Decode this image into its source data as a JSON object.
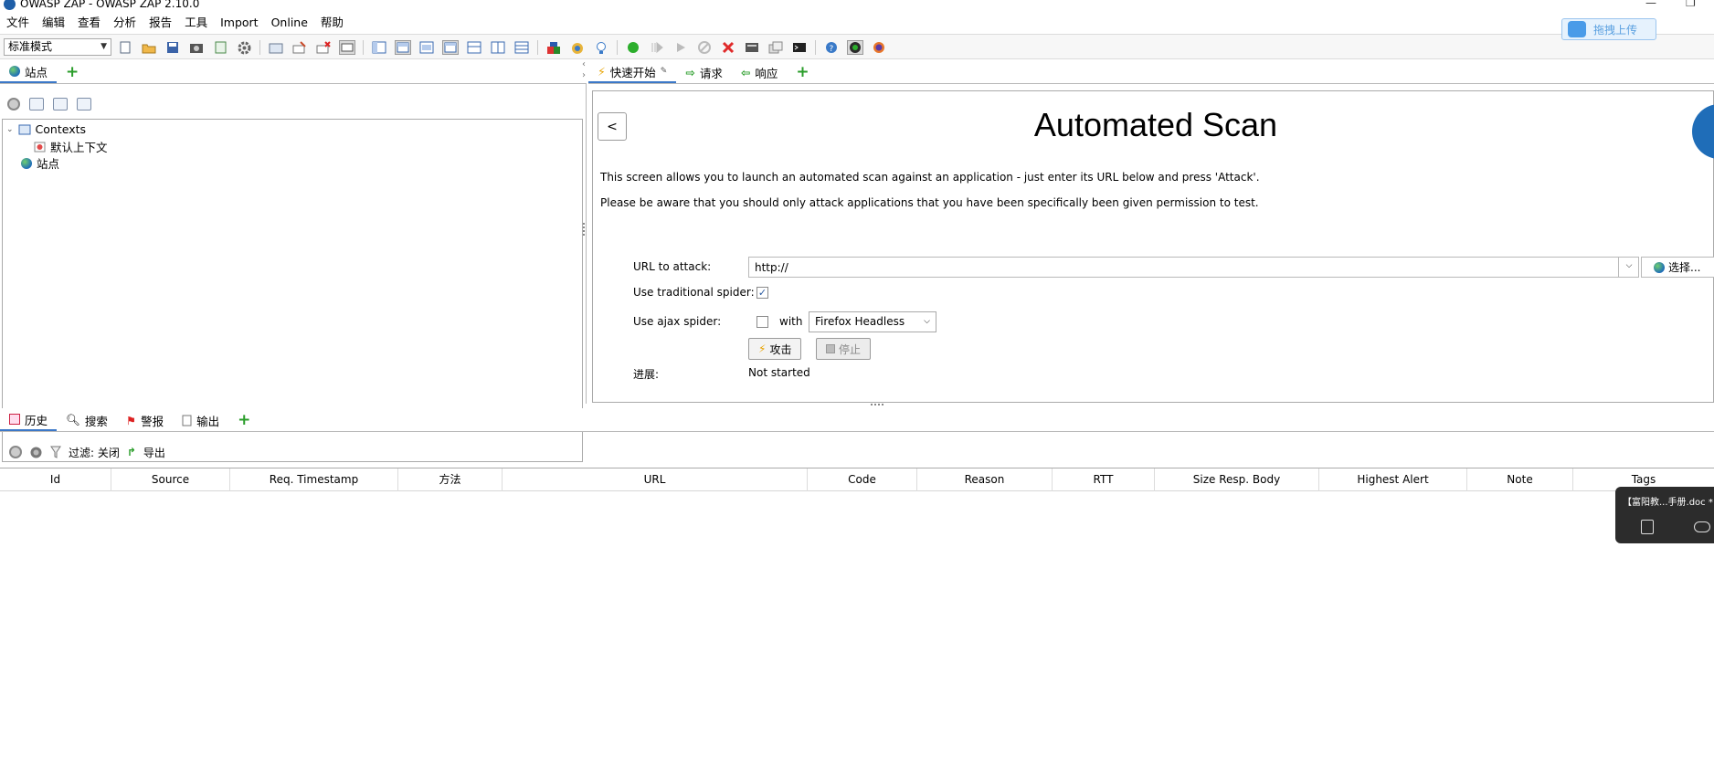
{
  "window": {
    "title": "OWASP ZAP - OWASP ZAP 2.10.0",
    "minimize": "—",
    "maximize": "❐"
  },
  "menu": [
    "文件",
    "编辑",
    "查看",
    "分析",
    "报告",
    "工具",
    "Import",
    "Online",
    "帮助"
  ],
  "toolbar": {
    "mode": "标准模式"
  },
  "sites_panel": {
    "tab_label": "站点",
    "tree": {
      "contexts": "Contexts",
      "default_context": "默认上下文",
      "sites": "站点"
    }
  },
  "right_panel": {
    "tabs": [
      {
        "label": "快速开始"
      },
      {
        "label": "请求"
      },
      {
        "label": "响应"
      }
    ],
    "back_label": "<",
    "title": "Automated Scan",
    "desc1": "This screen allows you to launch an automated scan against  an application - just enter its URL below and press 'Attack'.",
    "desc2": "Please be aware that you should only attack applications that you have been specifically been given permission to test.",
    "form": {
      "url_label": "URL to attack:",
      "url_value": "http://",
      "choose_label": "选择...",
      "traditional_label": "Use traditional spider:",
      "traditional_checked": true,
      "ajax_label": "Use ajax spider:",
      "ajax_checked": false,
      "with_label": "with",
      "browser": "Firefox Headless",
      "attack_label": "攻击",
      "stop_label": "停止",
      "progress_label": "进展:",
      "progress_value": "Not started"
    }
  },
  "lower_panel": {
    "tabs": [
      {
        "label": "历史"
      },
      {
        "label": "搜索"
      },
      {
        "label": "警报"
      },
      {
        "label": "输出"
      }
    ],
    "filter_label": "过滤: 关闭",
    "export_label": "导出",
    "columns": [
      "Id",
      "Source",
      "Req. Timestamp",
      "方法",
      "URL",
      "Code",
      "Reason",
      "RTT",
      "Size Resp. Body",
      "Highest Alert",
      "Note",
      "Tags"
    ]
  },
  "overlays": {
    "upload_label": "拖拽上传",
    "doc_label": "【富阳教...手册.doc *"
  },
  "colors": {
    "accent": "#3c78c8",
    "add_green": "#2a9d2a",
    "panel_border": "#aaaaaa"
  }
}
